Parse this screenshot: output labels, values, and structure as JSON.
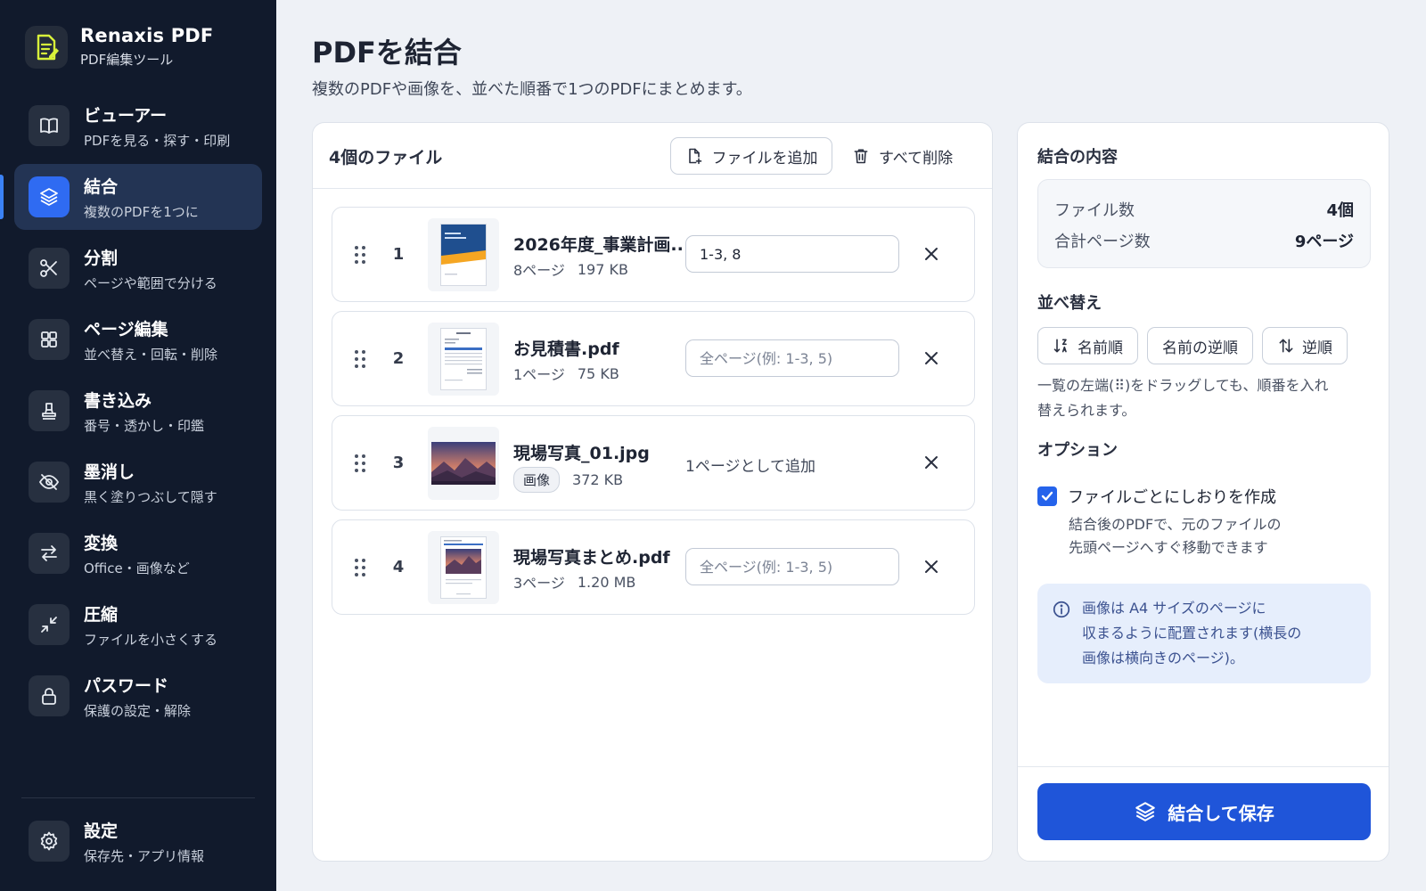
{
  "app": {
    "name": "Renaxis PDF",
    "subtitle": "PDF編集ツール",
    "logo_icon": "pdf-edit-icon",
    "accent_color": "#2f6bf2"
  },
  "sidebar": {
    "items": [
      {
        "label": "ビューアー",
        "desc": "PDFを見る・探す・印刷",
        "icon": "book-icon"
      },
      {
        "label": "結合",
        "desc": "複数のPDFを1つに",
        "icon": "layers-icon",
        "active": true
      },
      {
        "label": "分割",
        "desc": "ページや範囲で分ける",
        "icon": "scissors-icon"
      },
      {
        "label": "ページ編集",
        "desc": "並べ替え・回転・削除",
        "icon": "grid-icon"
      },
      {
        "label": "書き込み",
        "desc": "番号・透かし・印鑑",
        "icon": "stamp-icon"
      },
      {
        "label": "墨消し",
        "desc": "黒く塗りつぶして隠す",
        "icon": "eye-off-icon"
      },
      {
        "label": "変換",
        "desc": "Office・画像など",
        "icon": "swap-icon"
      },
      {
        "label": "圧縮",
        "desc": "ファイルを小さくする",
        "icon": "compress-icon"
      },
      {
        "label": "パスワード",
        "desc": "保護の設定・解除",
        "icon": "lock-icon"
      }
    ],
    "settings": {
      "label": "設定",
      "desc": "保存先・アプリ情報",
      "icon": "gear-icon"
    }
  },
  "page": {
    "title": "PDFを結合",
    "subtitle": "複数のPDFや画像を、並べた順番で1つのPDFにまとめます。"
  },
  "files_panel": {
    "count_label": "4個のファイル",
    "add_button": "ファイルを追加",
    "clear_button": "すべて削除",
    "files": [
      {
        "index": "1",
        "name": "2026年度_事業計画...",
        "pages": "8ページ",
        "size": "197 KB",
        "range_value": "1-3, 8",
        "range_placeholder": "全ページ(例: 1-3, 5)",
        "kind": "pdf-cover"
      },
      {
        "index": "2",
        "name": "お見積書.pdf",
        "pages": "1ページ",
        "size": "75 KB",
        "range_value": "",
        "range_placeholder": "全ページ(例: 1-3, 5)",
        "kind": "pdf-doc"
      },
      {
        "index": "3",
        "name": "現場写真_01.jpg",
        "tag": "画像",
        "size": "372 KB",
        "range_static": "1ページとして追加",
        "kind": "image"
      },
      {
        "index": "4",
        "name": "現場写真まとめ.pdf",
        "pages": "3ページ",
        "size": "1.20 MB",
        "range_value": "",
        "range_placeholder": "全ページ(例: 1-3, 5)",
        "kind": "pdf-photo"
      }
    ]
  },
  "summary": {
    "title": "結合の内容",
    "file_count_label": "ファイル数",
    "file_count_value": "4個",
    "total_pages_label": "合計ページ数",
    "total_pages_value": "9ページ",
    "sort_title": "並べ替え",
    "sort_buttons": {
      "by_name": "名前順",
      "by_name_reverse": "名前の逆順",
      "reverse": "逆順"
    },
    "sort_hint": "一覧の左端(⠿)をドラッグしても、順番を入れ替えられます。",
    "options_title": "オプション",
    "bookmark_option": "ファイルごとにしおりを作成",
    "bookmark_checked": true,
    "bookmark_desc_1": "結合後のPDFで、元のファイルの",
    "bookmark_desc_2": "先頭ページへすぐ移動できます",
    "info_line_1": "画像は A4 サイズのページに",
    "info_line_2": "収まるように配置されます(横長の",
    "info_line_3": "画像は横向きのページ)。",
    "merge_button": "結合して保存"
  }
}
